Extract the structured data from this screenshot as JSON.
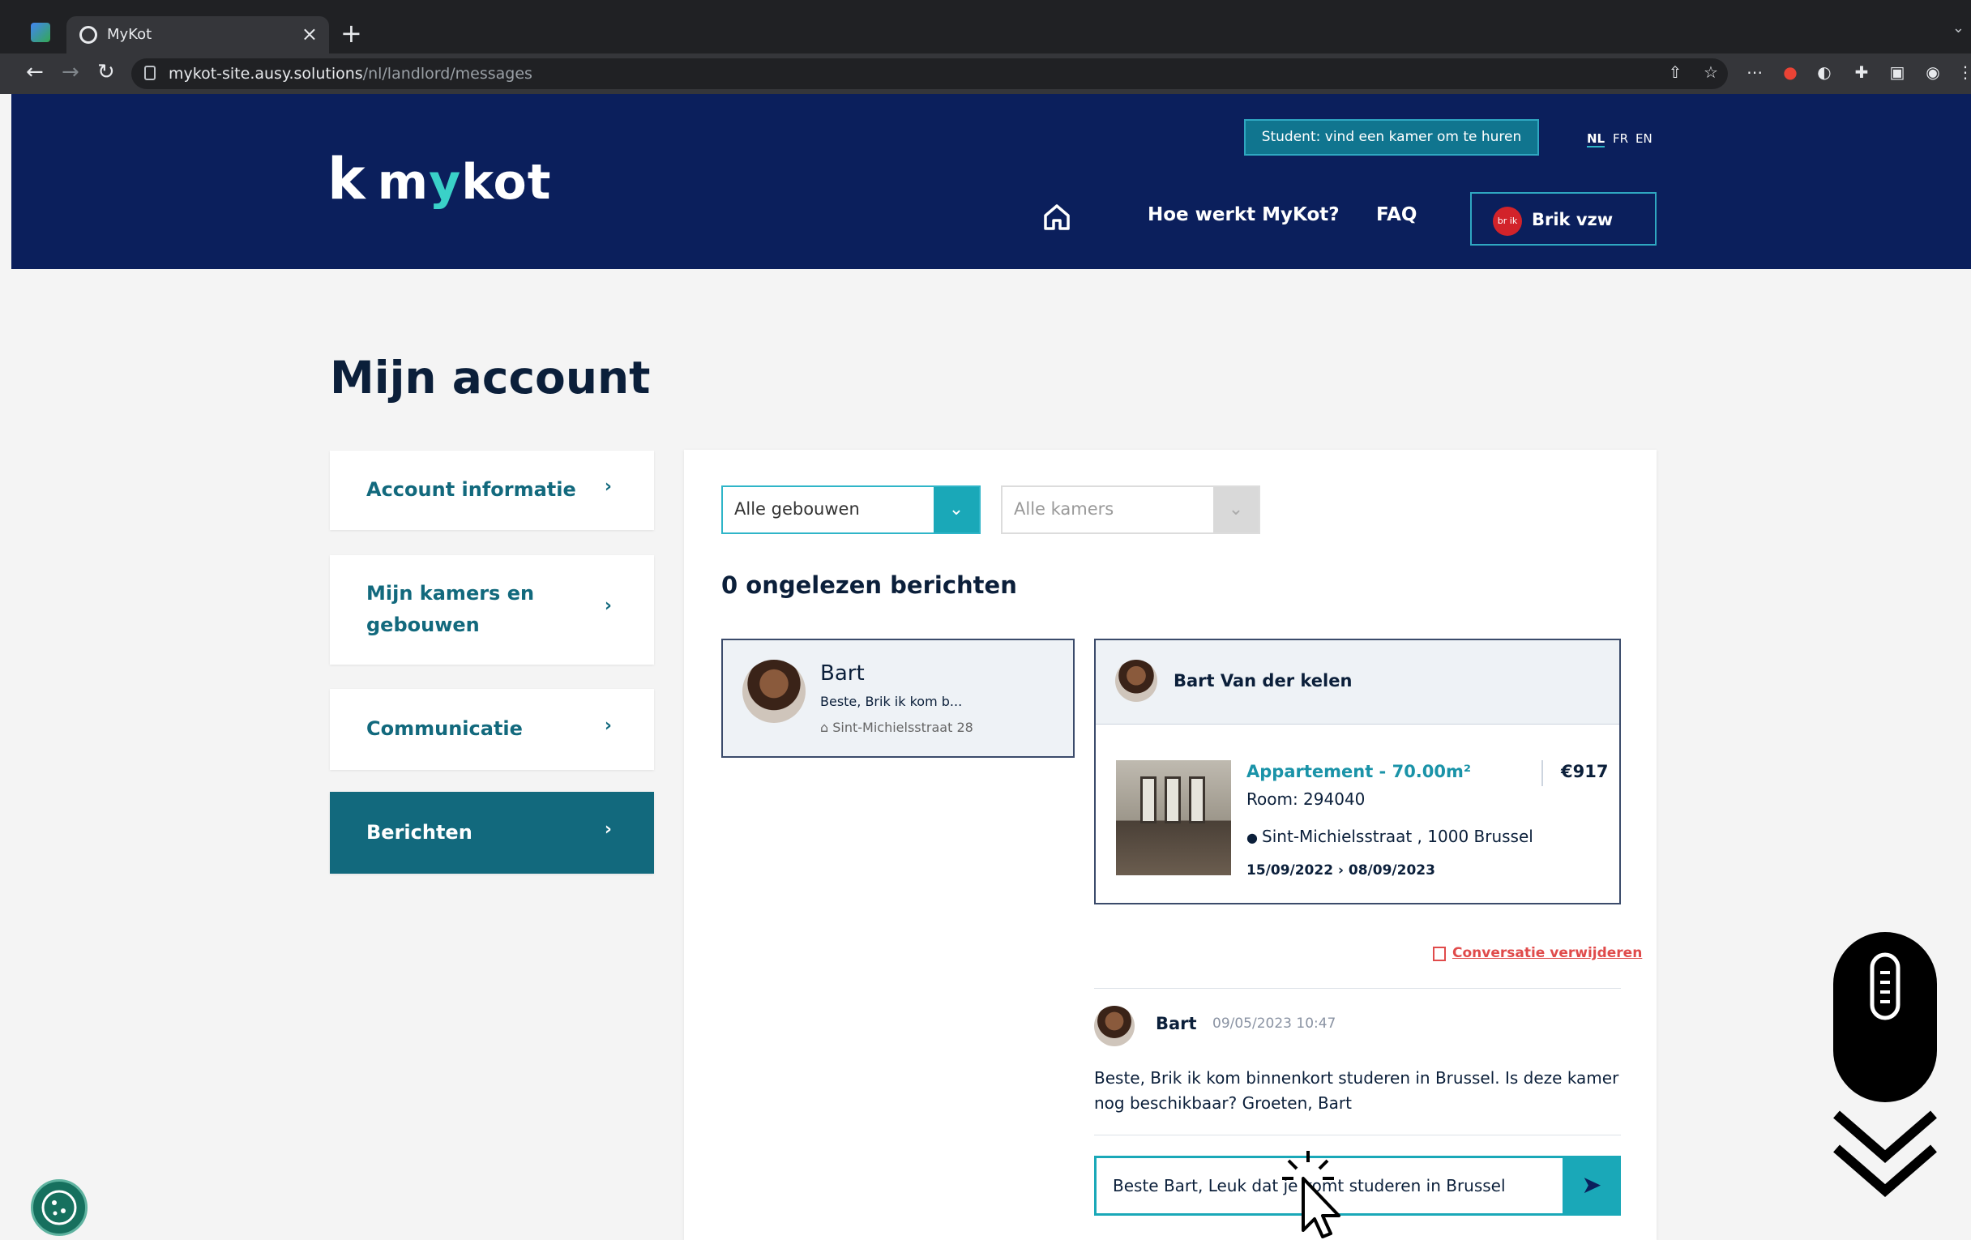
{
  "browser": {
    "tab_title": "MyKot",
    "url_host": "mykot-site.ausy.solutions",
    "url_path": "/nl/landlord/messages"
  },
  "header": {
    "logo_k": "k",
    "logo_my": "m",
    "logo_y": "y",
    "logo_kot": "kot",
    "student_cta": "Student: vind een kamer om te huren",
    "languages": [
      "NL",
      "FR",
      "EN"
    ],
    "nav": [
      "Hoe werkt MyKot?",
      "FAQ"
    ],
    "account_initials": "br ik",
    "account_name": "Brik vzw"
  },
  "page": {
    "title": "Mijn account"
  },
  "sidebar": {
    "items": [
      {
        "label": "Account informatie"
      },
      {
        "label": "Mijn kamers en gebouwen"
      },
      {
        "label": "Communicatie"
      },
      {
        "label": "Berichten"
      }
    ],
    "chevron": "›"
  },
  "filters": {
    "buildings": "Alle gebouwen",
    "rooms": "Alle kamers"
  },
  "messages": {
    "unread_count": "0 ongelezen berichten",
    "conversation": {
      "name": "Bart",
      "preview": "Beste, Brik ik kom b...",
      "address": "Sint-Michielsstraat 28"
    },
    "detail": {
      "contact_name": "Bart Van der kelen",
      "room_type": "Appartement - 70.00m²",
      "price": "€917",
      "room_id": "Room: 294040",
      "address": "Sint-Michielsstraat , 1000 Brussel",
      "dates": "15/09/2022 › 08/09/2023"
    },
    "delete_label": "Conversatie verwijderen",
    "message": {
      "sender": "Bart",
      "time": "09/05/2023 10:47",
      "text": "Beste, Brik ik kom binnenkort studeren in Brussel. Is deze kamer nog beschikbaar? Groeten, Bart"
    },
    "reply_value": "Beste Bart,  Leuk dat je komt studeren in Brussel"
  },
  "colors": {
    "brand_navy": "#0b1f5c",
    "accent_teal": "#1aa8b8",
    "sidebar_active": "#12697d",
    "danger": "#e04b4b"
  }
}
